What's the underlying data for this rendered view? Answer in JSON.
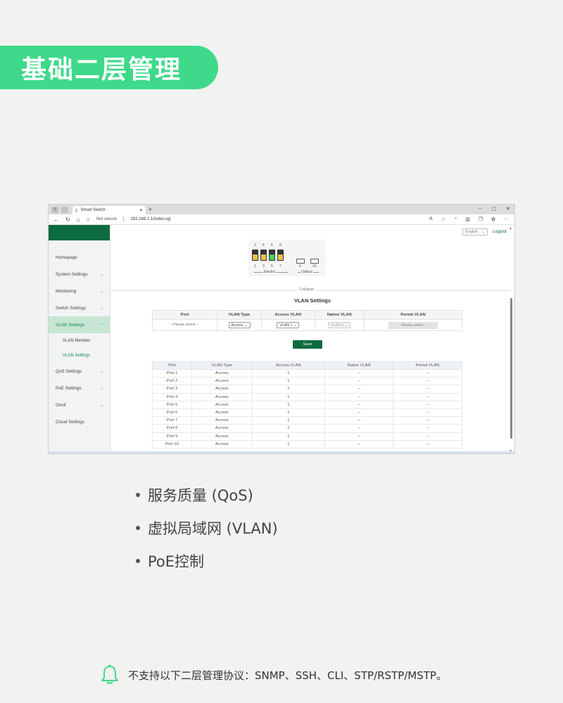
{
  "banner": {
    "title": "基础二层管理"
  },
  "browser": {
    "tab_title": "Smart Switch",
    "new_tab": "+",
    "security_label": "Not secure",
    "url": "192.168.2.1/index.cgi",
    "window_controls": [
      "–",
      "▢",
      "✕"
    ]
  },
  "sidebar": {
    "items": [
      {
        "label": "Homepage"
      },
      {
        "label": "System Settings"
      },
      {
        "label": "Monitoring"
      },
      {
        "label": "Switch Settings"
      },
      {
        "label": "VLAN Settings"
      },
      {
        "label": "QoS Settings"
      },
      {
        "label": "PoE Settings"
      },
      {
        "label": "Onvif"
      },
      {
        "label": "Cloud Settings"
      }
    ],
    "sub_items": [
      "VLAN Member",
      "VLAN Settings"
    ]
  },
  "header": {
    "language": "English",
    "logout": "Logout"
  },
  "ports": {
    "top_numbers": [
      "2",
      "4",
      "6",
      "8"
    ],
    "bottom_numbers": [
      "1",
      "3",
      "5",
      "7"
    ],
    "optical_numbers": [
      "9",
      "10"
    ],
    "electric_label": "Electric",
    "optical_label": "Optical"
  },
  "collapse_label": "Collapse",
  "section_title": "VLAN Settings",
  "form": {
    "headers": [
      "Port",
      "VLAN Type",
      "Access VLAN",
      "Native VLAN",
      "Permit VLAN"
    ],
    "port_value": "--Please select --",
    "vlan_type_value": "Access",
    "access_vlan_value": "VLAN 1",
    "native_vlan_value": "VLAN 1",
    "permit_vlan_value": "--Please select --"
  },
  "save_label": "Save",
  "list": {
    "headers": [
      "Port",
      "VLAN Type",
      "Access VLAN",
      "Native VLAN",
      "Permit VLAN"
    ],
    "rows": [
      [
        "Port 1",
        "Access",
        "1",
        "--",
        "--"
      ],
      [
        "Port 2",
        "Access",
        "1",
        "--",
        "--"
      ],
      [
        "Port 3",
        "Access",
        "1",
        "--",
        "--"
      ],
      [
        "Port 4",
        "Access",
        "1",
        "--",
        "--"
      ],
      [
        "Port 5",
        "Access",
        "1",
        "--",
        "--"
      ],
      [
        "Port 6",
        "Access",
        "1",
        "--",
        "--"
      ],
      [
        "Port 7",
        "Access",
        "1",
        "--",
        "--"
      ],
      [
        "Port 8",
        "Access",
        "1",
        "--",
        "--"
      ],
      [
        "Port 9",
        "Access",
        "1",
        "--",
        "--"
      ],
      [
        "Port 10",
        "Access",
        "1",
        "--",
        "--"
      ]
    ]
  },
  "bullets": [
    "服务质量 (QoS)",
    "虚拟局域网 (VLAN)",
    "PoE控制"
  ],
  "note": "不支持以下二层管理协议：SNMP、SSH、CLI、STP/RSTP/MSTP。",
  "colors": {
    "accent": "#3ed98a",
    "brand": "#0c6b3f"
  }
}
